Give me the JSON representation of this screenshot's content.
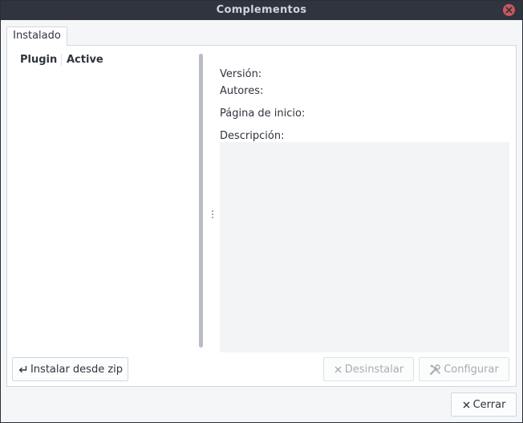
{
  "window": {
    "title": "Complementos"
  },
  "tabs": [
    {
      "label": "Instalado",
      "active": true
    }
  ],
  "plugin_list": {
    "columns": [
      "Plugin",
      "Active"
    ],
    "rows": []
  },
  "details": {
    "version_label": "Versión:",
    "authors_label": "Autores:",
    "homepage_label": "Página de inicio:",
    "description_label": "Descripción:",
    "description_text": ""
  },
  "buttons": {
    "install_zip": "Instalar desde zip",
    "uninstall": "Desinstalar",
    "configure": "Configurar",
    "close": "Cerrar"
  },
  "icons": {
    "window_close": "close-circle-icon",
    "install_zip": "enter-arrow-icon",
    "uninstall": "x-icon",
    "configure": "tools-icon",
    "close": "x-icon"
  },
  "colors": {
    "titlebar": "#2f343f",
    "close_button": "#cc575d",
    "window_bg": "#f5f6f7",
    "panel_bg": "#ffffff",
    "description_bg": "#f3f4f5"
  }
}
